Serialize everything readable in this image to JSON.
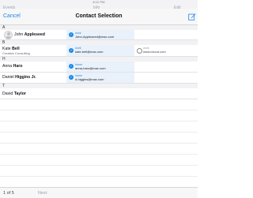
{
  "status": {
    "time": "8:12 PM"
  },
  "background_nav": {
    "left": "Events",
    "center": "Info",
    "right": "Edit"
  },
  "nav": {
    "cancel": "Cancel",
    "title": "Contact Selection",
    "compose_icon": "compose-icon"
  },
  "sections": [
    {
      "letter": "A"
    },
    {
      "letter": "B"
    },
    {
      "letter": "H"
    },
    {
      "letter": "T"
    }
  ],
  "contacts": [
    {
      "first": "John",
      "last": "Appleseed",
      "company": "",
      "emails": [
        {
          "label": "work",
          "value": "John-Appleseed@mac.com",
          "selected": true
        }
      ]
    },
    {
      "first": "Kate",
      "last": "Bell",
      "company": "Creative Consulting",
      "emails": [
        {
          "label": "work",
          "value": "kate-bell@mac.com",
          "selected": true
        },
        {
          "label": "work",
          "value": "www.icloud.com",
          "selected": false
        }
      ]
    },
    {
      "first": "Anna",
      "last": "Haro",
      "company": "",
      "emails": [
        {
          "label": "home",
          "value": "anna-haro@mac.com",
          "selected": true
        }
      ]
    },
    {
      "first": "Daniel",
      "last": "Higgins Jr.",
      "company": "",
      "emails": [
        {
          "label": "home",
          "value": "d-higgins@mac.com",
          "selected": true
        }
      ]
    },
    {
      "first": "David",
      "last": "Taylor",
      "company": "",
      "emails": []
    }
  ],
  "footer": {
    "page": "1 of 5",
    "next": "Next"
  },
  "colors": {
    "accent": "#1e88e5",
    "selected_bg": "#e9f1fb"
  }
}
